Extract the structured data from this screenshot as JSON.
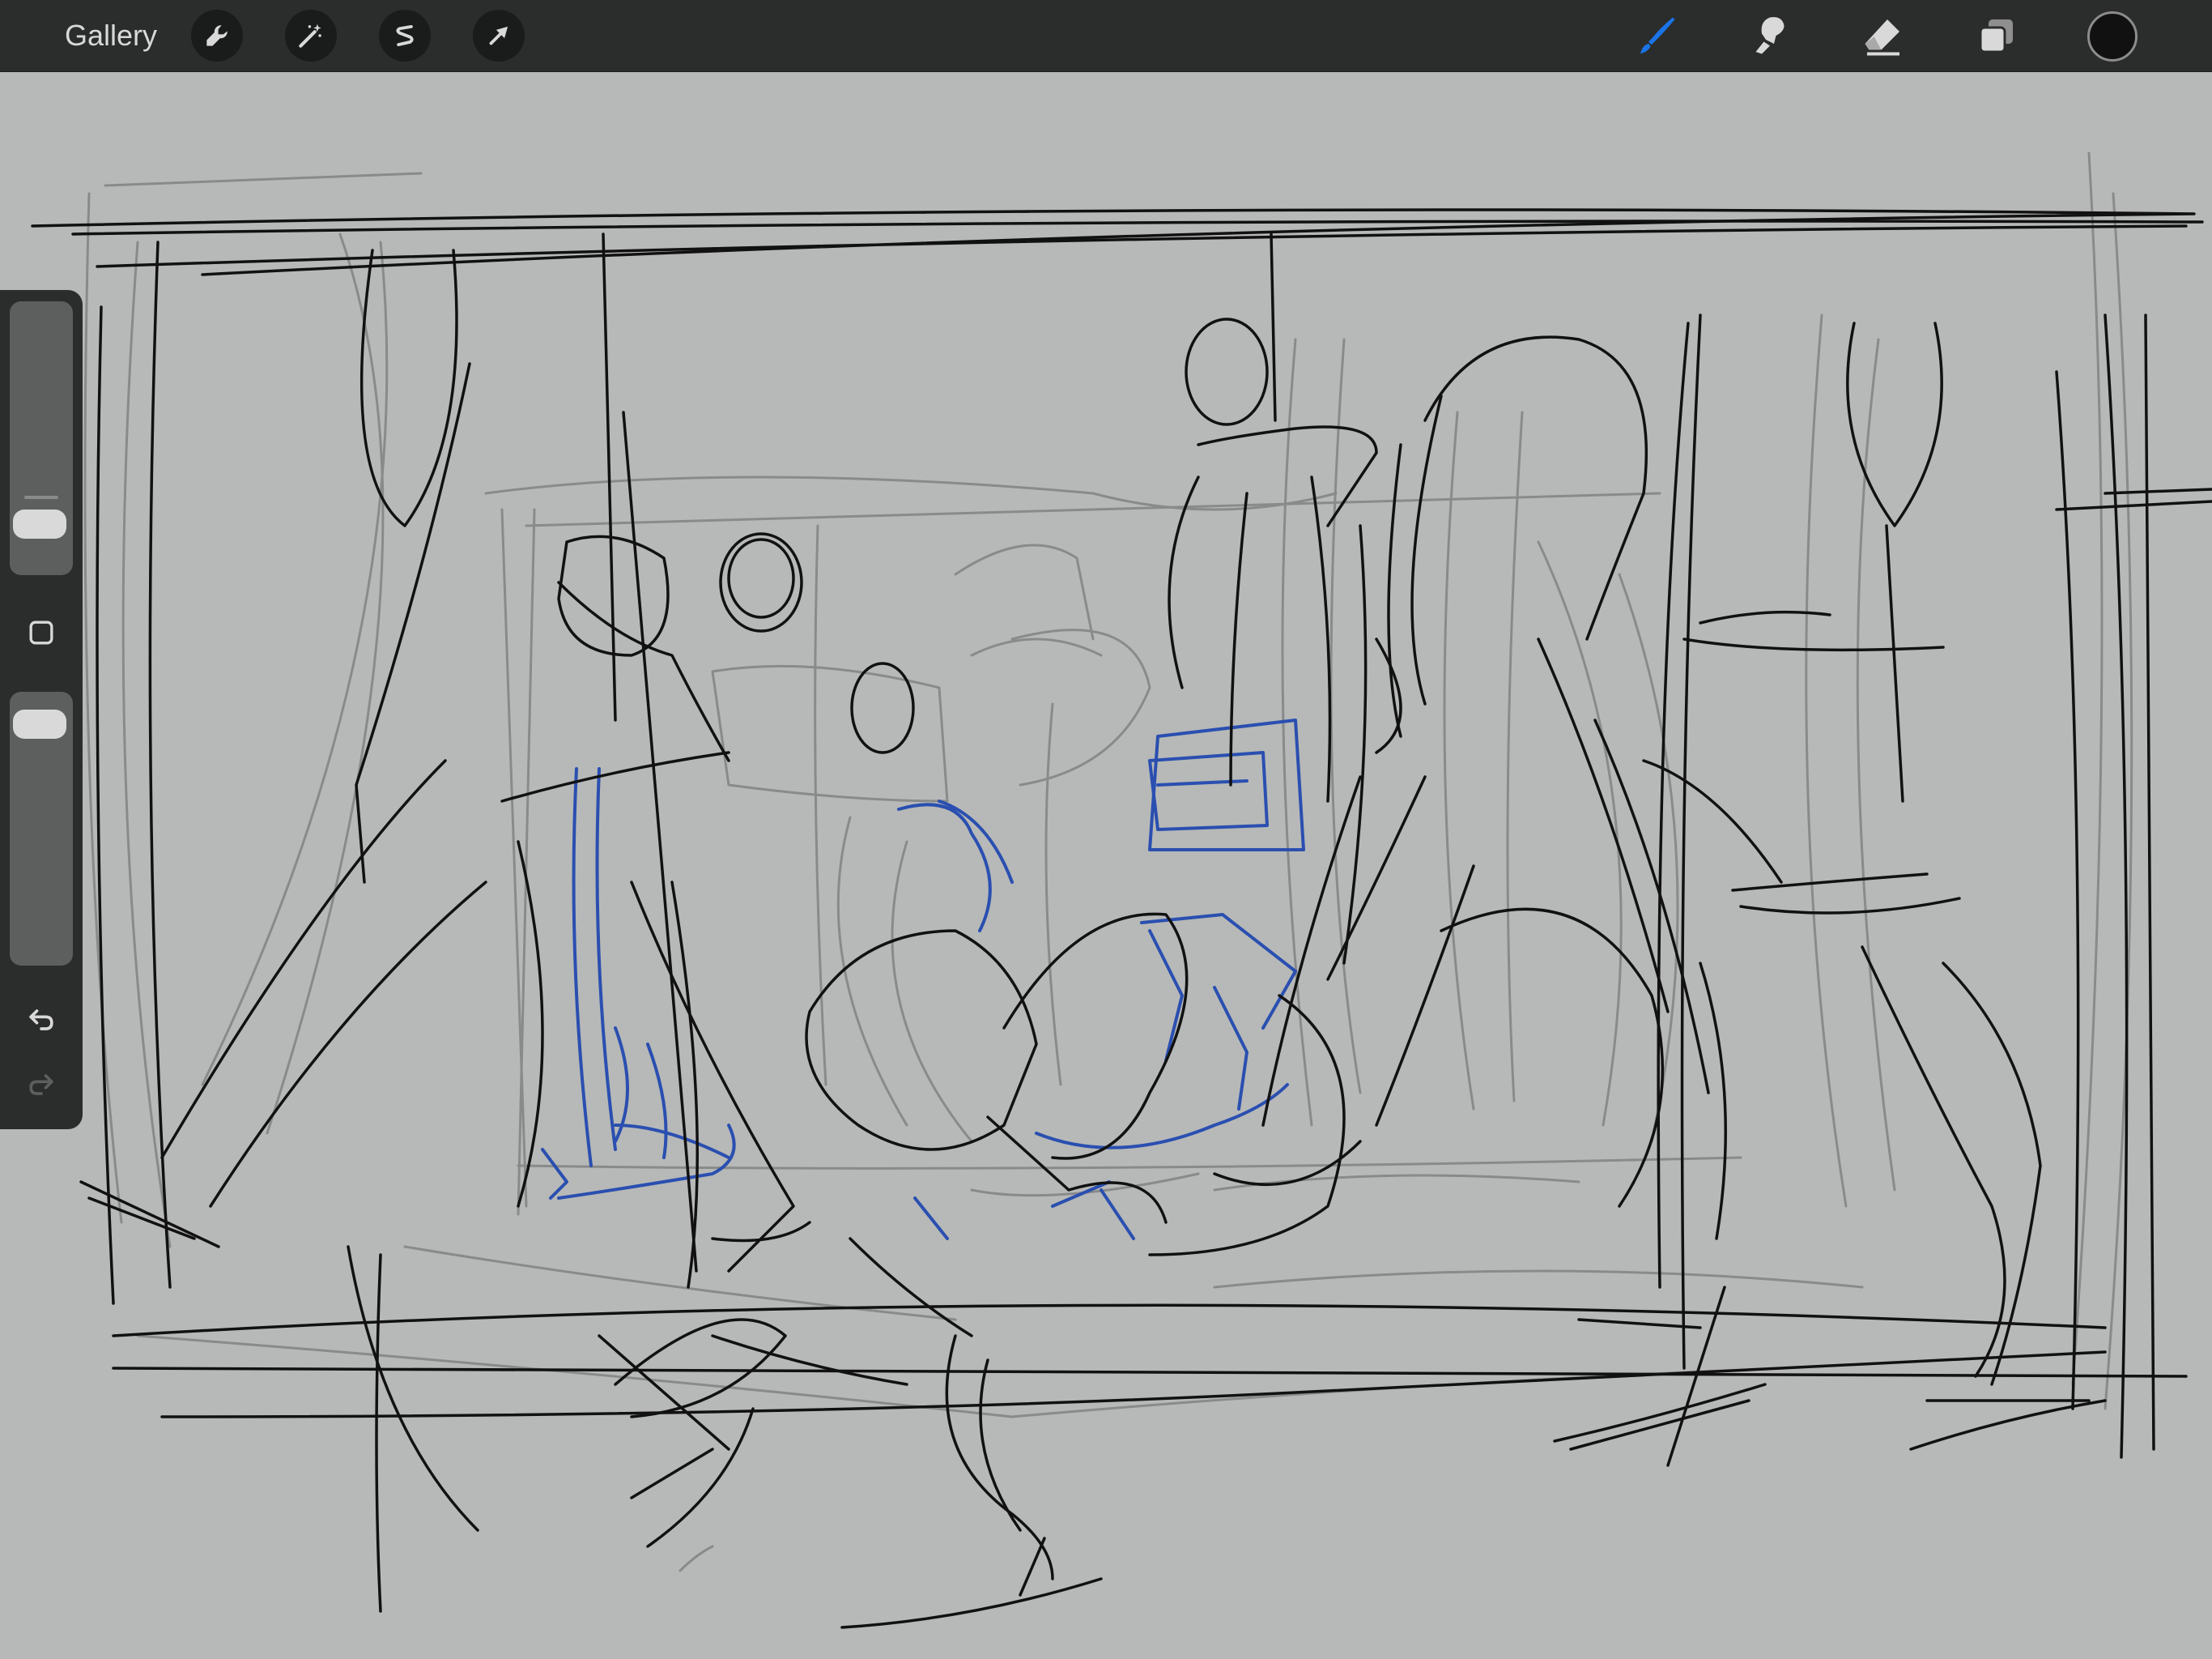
{
  "topbar": {
    "gallery_label": "Gallery",
    "left_tools": [
      {
        "name": "actions",
        "icon": "wrench-icon"
      },
      {
        "name": "adjustments",
        "icon": "magic-wand-icon"
      },
      {
        "name": "selection",
        "icon": "selection-s-icon"
      },
      {
        "name": "transform",
        "icon": "arrow-cursor-icon"
      }
    ],
    "right_tools": [
      {
        "name": "brush",
        "icon": "brush-icon",
        "active": true
      },
      {
        "name": "smudge",
        "icon": "smudge-icon",
        "active": false
      },
      {
        "name": "eraser",
        "icon": "eraser-icon",
        "active": false
      },
      {
        "name": "layers",
        "icon": "layers-icon",
        "active": false
      }
    ],
    "current_color": "#111111"
  },
  "colors": {
    "accent": "#1a74e8",
    "toolbar_bg": "#2b2c2c",
    "canvas_bg": "#b7b9b8",
    "sketch_dark": "#111111",
    "sketch_grey": "#6a6a6a",
    "sketch_blue": "#2a4fb0"
  },
  "sidebar": {
    "brush_size_level": 0.14,
    "opacity_level": 0.06,
    "modify_button_icon": "square-icon",
    "undo_icon": "undo-icon",
    "redo_icon": "redo-icon",
    "redo_enabled": false
  }
}
